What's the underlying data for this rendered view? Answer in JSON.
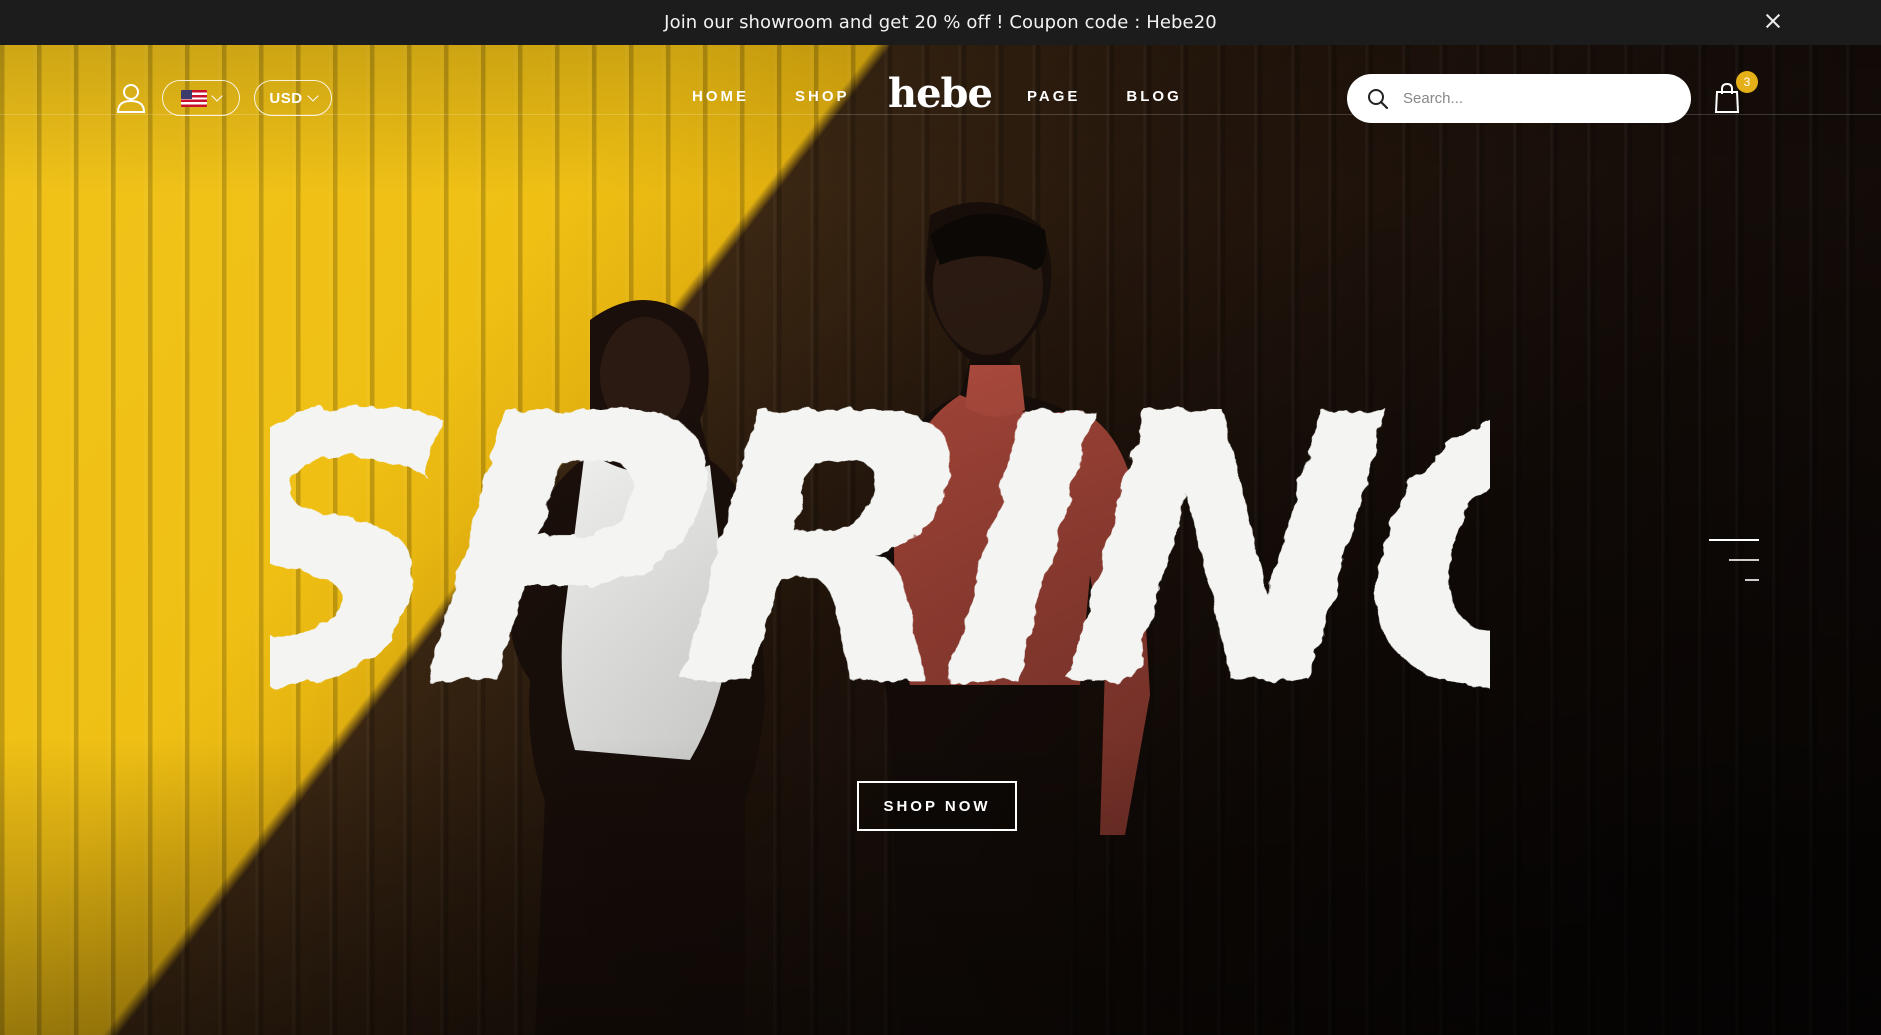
{
  "announcement": {
    "text": "Join our showroom and get 20 % off ! Coupon code : Hebe20",
    "close_icon": "close-icon"
  },
  "header": {
    "user_icon": "user-icon",
    "language": {
      "flag": "us-flag-icon",
      "chevron": "chevron-down-icon"
    },
    "currency": {
      "label": "USD"
    },
    "nav_left": [
      "HOME",
      "SHOP"
    ],
    "logo": "hebe",
    "nav_right": [
      "PAGE",
      "BLOG"
    ],
    "search": {
      "placeholder": "Search...",
      "icon": "search-icon"
    },
    "cart": {
      "icon": "shopping-bag-icon",
      "count": "3"
    }
  },
  "hero": {
    "headline": "SPRING",
    "cta_label": "SHOP NOW",
    "slider_nav": {
      "icon": "slide-indicator-lines"
    },
    "colors": {
      "wall_yellow": "#f1c31a",
      "shadow": "#140c08",
      "badge": "#e5b017"
    }
  }
}
